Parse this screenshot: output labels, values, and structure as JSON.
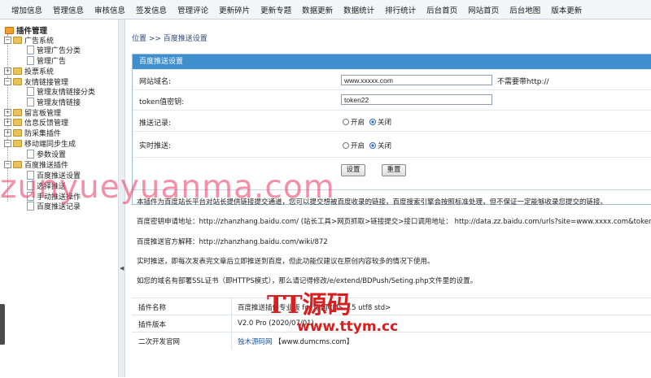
{
  "nav": [
    "增加信息",
    "管理信息",
    "审核信息",
    "签发信息",
    "管理评论",
    "更新碎片",
    "更新专题",
    "数据更新",
    "数据统计",
    "排行统计",
    "后台首页",
    "网站首页",
    "后台地图",
    "版本更新"
  ],
  "sidebar": {
    "title": "插件管理",
    "items": [
      {
        "label": "广告系统",
        "level": 0
      },
      {
        "label": "管理广告分类",
        "level": 1
      },
      {
        "label": "管理广告",
        "level": 1
      },
      {
        "label": "投票系统",
        "level": 0
      },
      {
        "label": "友情链接管理",
        "level": 0
      },
      {
        "label": "管理友情链接分类",
        "level": 1
      },
      {
        "label": "管理友情链接",
        "level": 1
      },
      {
        "label": "留言板管理",
        "level": 0
      },
      {
        "label": "信息反馈管理",
        "level": 0
      },
      {
        "label": "防采集插件",
        "level": 0
      },
      {
        "label": "移动端同步生成",
        "level": 0
      },
      {
        "label": "参数设置",
        "level": 1
      },
      {
        "label": "百度推送插件",
        "level": 0
      },
      {
        "label": "百度推送设置",
        "level": 1
      },
      {
        "label": "选择推送",
        "level": 1
      },
      {
        "label": "手动推送操作",
        "level": 1
      },
      {
        "label": "百度推送记录",
        "level": 1
      }
    ]
  },
  "breadcrumb": "位置 >> 百度推送设置",
  "panel": {
    "title": "百度推送设置",
    "domain_label": "网站域名:",
    "domain_value": "www.xxxxx.com",
    "domain_hint": "不需要带http://",
    "token_label": "token值密钥:",
    "token_value": "token22",
    "log_label": "推送记录:",
    "realtime_label": "实时推送:",
    "opt_on": "开启",
    "opt_off": "关闭",
    "save": "设置",
    "reset": "重置"
  },
  "info": [
    "本插件为百度站长平台对站长提供链接提交通道，您可以提交想被百度收录的链接，百度搜索引擎会按照标准处理，但不保证一定能够收录您提交的链接。",
    "百度密钥申请地址：http://zhanzhang.baidu.com/ (站长工具>网页抓取>链接提交>接口调用地址：  http://data.zz.baidu.com/urls?site=www.xxxx.com&token=token",
    "百度推送官方解释：http://zhanzhang.baidu.com/wiki/872",
    "实时推送，即每次发表完文章后立即推送到百度，但此功能仅建议在原创内容较多的情况下使用。",
    "如您的域名有部署SSL证书（即HTTPS模式），那么请记得修改/e/extend/BDPush/Seting.php文件里的设置。"
  ],
  "meta": [
    {
      "label": "插件名称",
      "value": "百度推送插件专业版 for 帝国CMS 7.5 utf8 std>"
    },
    {
      "label": "插件版本",
      "value": "V2.0 Pro  (2020/07/01)"
    },
    {
      "label": "二次开发官网",
      "link": "独木源码网",
      "value": "【www.dumcms.com】"
    }
  ],
  "watermarks": {
    "main": "zunyueyuanma.com",
    "logo": "TT源码",
    "url": "www.ttym.cc"
  }
}
